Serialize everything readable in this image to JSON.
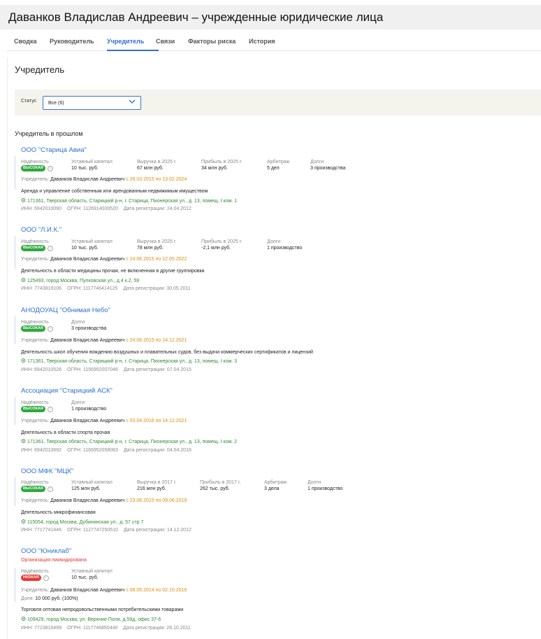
{
  "page": {
    "title": "Даванков Владислав Андреевич – учрежденные юридические лица"
  },
  "tabs": [
    {
      "label": "Сводка",
      "active": false
    },
    {
      "label": "Руководитель",
      "active": false
    },
    {
      "label": "Учредитель",
      "active": true
    },
    {
      "label": "Связи",
      "active": false
    },
    {
      "label": "Факторы риска",
      "active": false
    },
    {
      "label": "История",
      "active": false
    }
  ],
  "section": {
    "title": "Учредитель"
  },
  "filter": {
    "label": "Статус",
    "value": "Все (6)"
  },
  "past_header": "Учредитель в прошлом",
  "colors": {
    "accent": "#2d6fd6",
    "high_badge": "#2ea83c",
    "low_badge": "#e53935",
    "date": "#e08a0c",
    "address": "#2f8a32"
  },
  "orgs": [
    {
      "name": "ООО \"Старица Авиа\"",
      "reliability_label": "Надёжность",
      "reliability": "ВЫСОКАЯ",
      "metrics": [
        {
          "label": "Уставный капитал",
          "value": "10 тыс. руб."
        },
        {
          "label": "Выручка в 2025 г.",
          "value": "67 млн руб."
        },
        {
          "label": "Прибыль в 2025 г.",
          "value": "34 млн руб."
        },
        {
          "label": "Арбитраж",
          "value": "5 дел"
        },
        {
          "label": "Долги",
          "value": "3 производства"
        }
      ],
      "founders_prefix": "Учредитель:",
      "founder": "Даванков Владислав Андреевич",
      "period": "с 26.03.2015 по 13.02.2024",
      "activity": "Аренда и управление собственным или арендованным недвижимым имуществом",
      "address": "171361, Тверская область, Старицкий р-н, г. Старица, Пионерская ул., д. 13, помещ. I ком. 1",
      "inn": "ИНН: 6942010090",
      "ogrn": "ОГРН: 1126914000520",
      "reg": "Дата регистрации: 24.04.2012"
    },
    {
      "name": "ООО \"Л.И.К.\"",
      "reliability_label": "Надёжность",
      "reliability": "ВЫСОКАЯ",
      "metrics": [
        {
          "label": "Уставный капитал",
          "value": "10 тыс. руб."
        },
        {
          "label": "Выручка в 2025 г.",
          "value": "78 млн руб."
        },
        {
          "label": "Прибыль в 2025 г.",
          "value": "-2,1 млн руб."
        },
        {
          "label": "Долги",
          "value": "1 производство"
        }
      ],
      "founders_prefix": "Учредитель:",
      "founder": "Даванков Владислав Андреевич",
      "period": "с 24.06.2015 по 12.05.2022",
      "activity": "Деятельность в области медицины прочая, не включенная в другие группировки",
      "address": "125493, город Москва, Пулковская ул., д.4 к.2, 59",
      "inn": "ИНН: 7743819106",
      "ogrn": "ОГРН: 1117746414125",
      "reg": "Дата регистрации: 30.05.2011"
    },
    {
      "name": "АНОДОУАЦ \"Обнимая Небо\"",
      "reliability_label": "Надёжность",
      "reliability": "ВЫСОКАЯ",
      "metrics": [
        {
          "label": "Долги",
          "value": "3 производства"
        }
      ],
      "founders_prefix": "Учредитель:",
      "founder": "Даванков Владислав Андреевич",
      "period": "с 24.06.2015 по 14.12.2021",
      "activity": "Деятельность школ обучения вождению воздушных и плавательных судов, без выдачи коммерческих сертификатов и лицензий",
      "address": "171361, Тверская область, Старицкий р-н, г. Старица, Пионерская ул., д. 13, помещ. I ком. 3",
      "inn": "ИНН: 6942010526",
      "ogrn": "ОГРН: 1156952007046",
      "reg": "Дата регистрации: 07.04.2015"
    },
    {
      "name": "Ассоциация \"Старицкий АСК\"",
      "reliability_label": "Надёжность",
      "reliability": "ВЫСОКАЯ",
      "metrics": [
        {
          "label": "Долги",
          "value": "1 производство"
        }
      ],
      "founders_prefix": "Учредитель:",
      "founder": "Даванков Владислав Андреевич",
      "period": "с 03.04.2016 по 14.12.2021",
      "activity": "Деятельность в области спорта прочая",
      "address": "171361, Тверская область, Старицкий р-н, г. Старица, Пионерская ул., д. 13, помещ. I ком. 2",
      "inn": "ИНН: 6942010692",
      "ogrn": "ОГРН: 1166952058063",
      "reg": "Дата регистрации: 04.04.2016"
    },
    {
      "name": "ООО МФК \"МЦК\"",
      "reliability_label": "Надёжность",
      "reliability": "ВЫСОКАЯ",
      "metrics": [
        {
          "label": "Уставный капитал",
          "value": "125 млн руб."
        },
        {
          "label": "Выручка в 2017 г.",
          "value": "216 млн руб."
        },
        {
          "label": "Прибыль в 2017 г.",
          "value": "262 тыс. руб."
        },
        {
          "label": "Арбитраж",
          "value": "3 дела"
        },
        {
          "label": "Долги",
          "value": "1 производство"
        }
      ],
      "founders_prefix": "Учредитель:",
      "founder": "Даванков Владислав Андреевич",
      "period": "с 23.06.2015 по 09.06.2019",
      "activity": "Деятельность микрофинансовая",
      "address": "115054, город Москва, Дубининская ул., д. 57 стр 7",
      "inn": "ИНН: 7717741446",
      "ogrn": "ОГРН: 1127747250510",
      "reg": "Дата регистрации: 14.12.2012"
    },
    {
      "name": "ООО \"Юниклаб\"",
      "liquidated": "Организация ликвидирована",
      "reliability_label": "Надёжность",
      "reliability": "НИЗКАЯ",
      "metrics": [
        {
          "label": "Уставный капитал",
          "value": "10 тыс. руб."
        }
      ],
      "founders_prefix": "Учредитель:",
      "founder": "Даванков Владислав Андреевич",
      "period": "с 08.05.2014 по 02.10.2016",
      "share_prefix": "Доля:",
      "share": "10 000 руб. (100%)",
      "activity": "Торговля оптовая непродовольственными потребительскими товарами",
      "address": "109429, город Москва, ул. Верхние Поля, д.59д, офис 37-6",
      "inn": "ИНН: 7723816499",
      "ogrn": "ОГРН: 1117746850440",
      "reg": "Дата регистрации: 26.10.2011"
    }
  ]
}
